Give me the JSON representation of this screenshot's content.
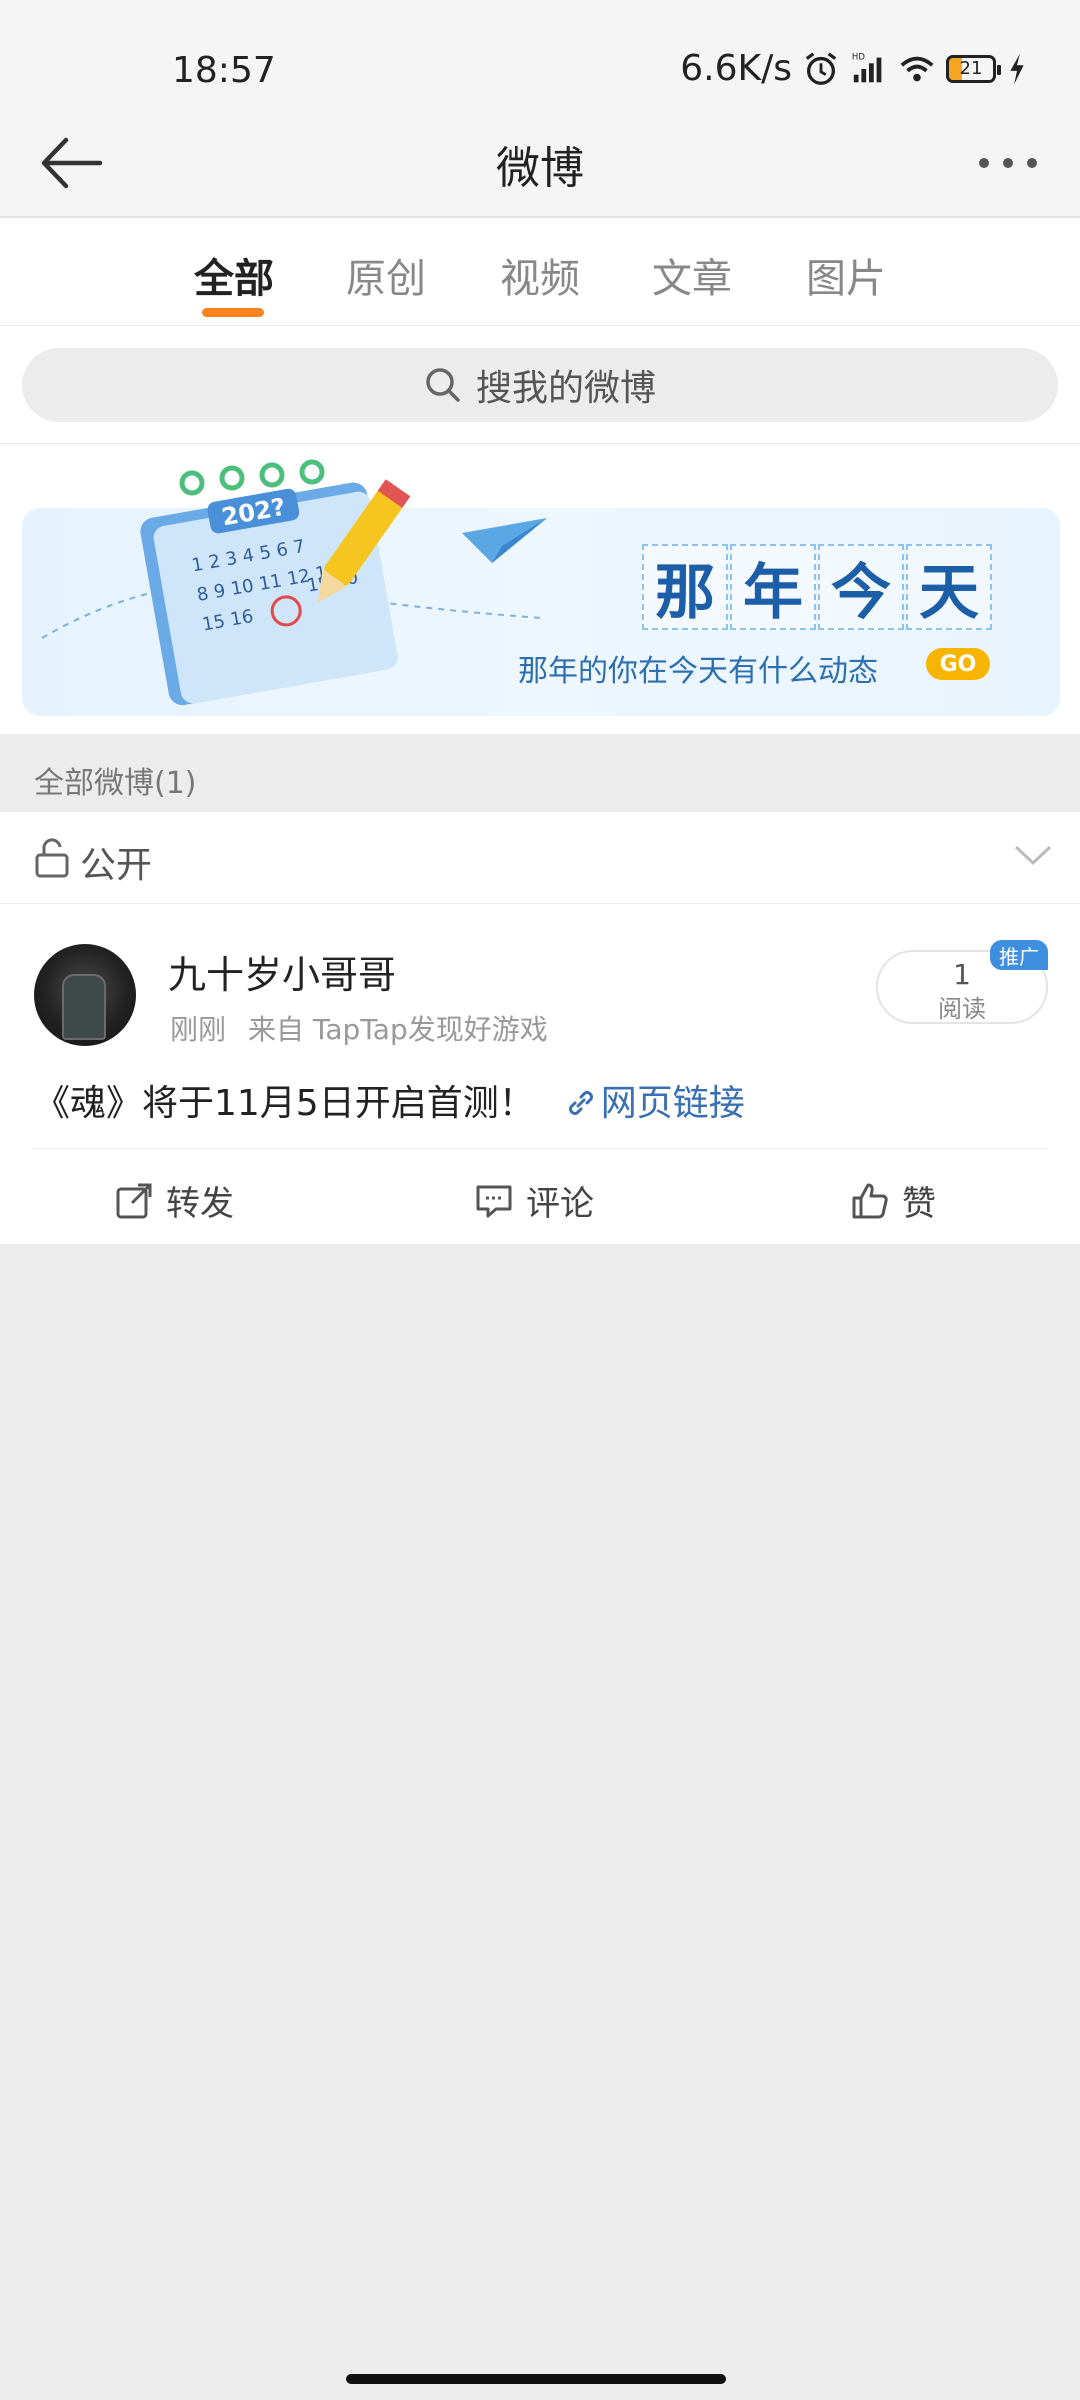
{
  "status_bar": {
    "time": "18:57",
    "speed": "6.6K/s",
    "battery": "21"
  },
  "nav": {
    "title": "微博"
  },
  "tabs": [
    {
      "label": "全部",
      "active": true
    },
    {
      "label": "原创",
      "active": false
    },
    {
      "label": "视频",
      "active": false
    },
    {
      "label": "文章",
      "active": false
    },
    {
      "label": "图片",
      "active": false
    }
  ],
  "search": {
    "placeholder": "搜我的微博"
  },
  "banner": {
    "title_chars": [
      "那",
      "年",
      "今",
      "天"
    ],
    "subtitle": "那年的你在今天有什么动态",
    "go_label": "GO"
  },
  "section": {
    "header": "全部微博(1)",
    "visibility": "公开"
  },
  "post": {
    "username": "九十岁小哥哥",
    "time": "刚刚",
    "source": "来自 TapTap发现好游戏",
    "read_count": "1",
    "read_label": "阅读",
    "promo_badge": "推广",
    "text": "《魂》将于11月5日开启首测！",
    "link_text": "网页链接",
    "actions": {
      "repost": "转发",
      "comment": "评论",
      "like": "赞"
    }
  },
  "colors": {
    "accent": "#f7831f",
    "link": "#3a6fb3",
    "background": "#ececec"
  }
}
